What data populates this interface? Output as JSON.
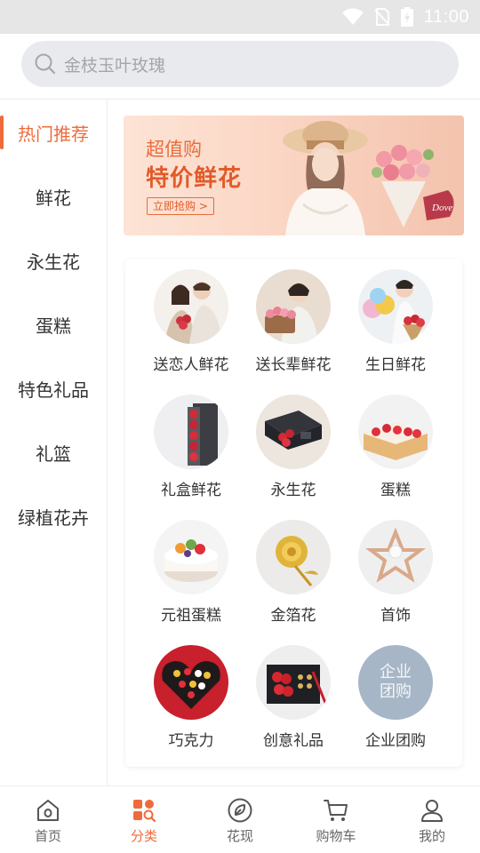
{
  "status_bar": {
    "time": "11:00"
  },
  "search": {
    "placeholder": "金枝玉叶玫瑰"
  },
  "sidebar": {
    "items": [
      {
        "label": "热门推荐",
        "active": true
      },
      {
        "label": "鲜花",
        "active": false
      },
      {
        "label": "永生花",
        "active": false
      },
      {
        "label": "蛋糕",
        "active": false
      },
      {
        "label": "特色礼品",
        "active": false
      },
      {
        "label": "礼篮",
        "active": false
      },
      {
        "label": "绿植花卉",
        "active": false
      }
    ]
  },
  "banner": {
    "line1": "超值购",
    "line2": "特价鲜花",
    "cta": "立即抢购 >",
    "brand": "Dove"
  },
  "categories": [
    {
      "label": "送恋人鲜花",
      "icon": "couple-flowers-image"
    },
    {
      "label": "送长辈鲜花",
      "icon": "elder-flowers-image"
    },
    {
      "label": "生日鲜花",
      "icon": "birthday-flowers-image"
    },
    {
      "label": "礼盒鲜花",
      "icon": "giftbox-flowers-image"
    },
    {
      "label": "永生花",
      "icon": "preserved-flower-image"
    },
    {
      "label": "蛋糕",
      "icon": "cake-image"
    },
    {
      "label": "元祖蛋糕",
      "icon": "fruit-cake-image"
    },
    {
      "label": "金箔花",
      "icon": "gold-foil-rose-image"
    },
    {
      "label": "首饰",
      "icon": "jewelry-image"
    },
    {
      "label": "巧克力",
      "icon": "chocolate-image"
    },
    {
      "label": "创意礼品",
      "icon": "creative-gift-image"
    },
    {
      "label": "企业团购",
      "icon": "enterprise-group-buy-image",
      "text": "企业团购"
    }
  ],
  "tabbar": {
    "items": [
      {
        "label": "首页",
        "icon": "home-icon",
        "active": false
      },
      {
        "label": "分类",
        "icon": "category-icon",
        "active": true
      },
      {
        "label": "花现",
        "icon": "discover-icon",
        "active": false
      },
      {
        "label": "购物车",
        "icon": "cart-icon",
        "active": false
      },
      {
        "label": "我的",
        "icon": "profile-icon",
        "active": false
      }
    ]
  },
  "colors": {
    "accent": "#ef6b3b",
    "search_bg": "#e8eaee",
    "status_bg": "#e6e6e6"
  }
}
